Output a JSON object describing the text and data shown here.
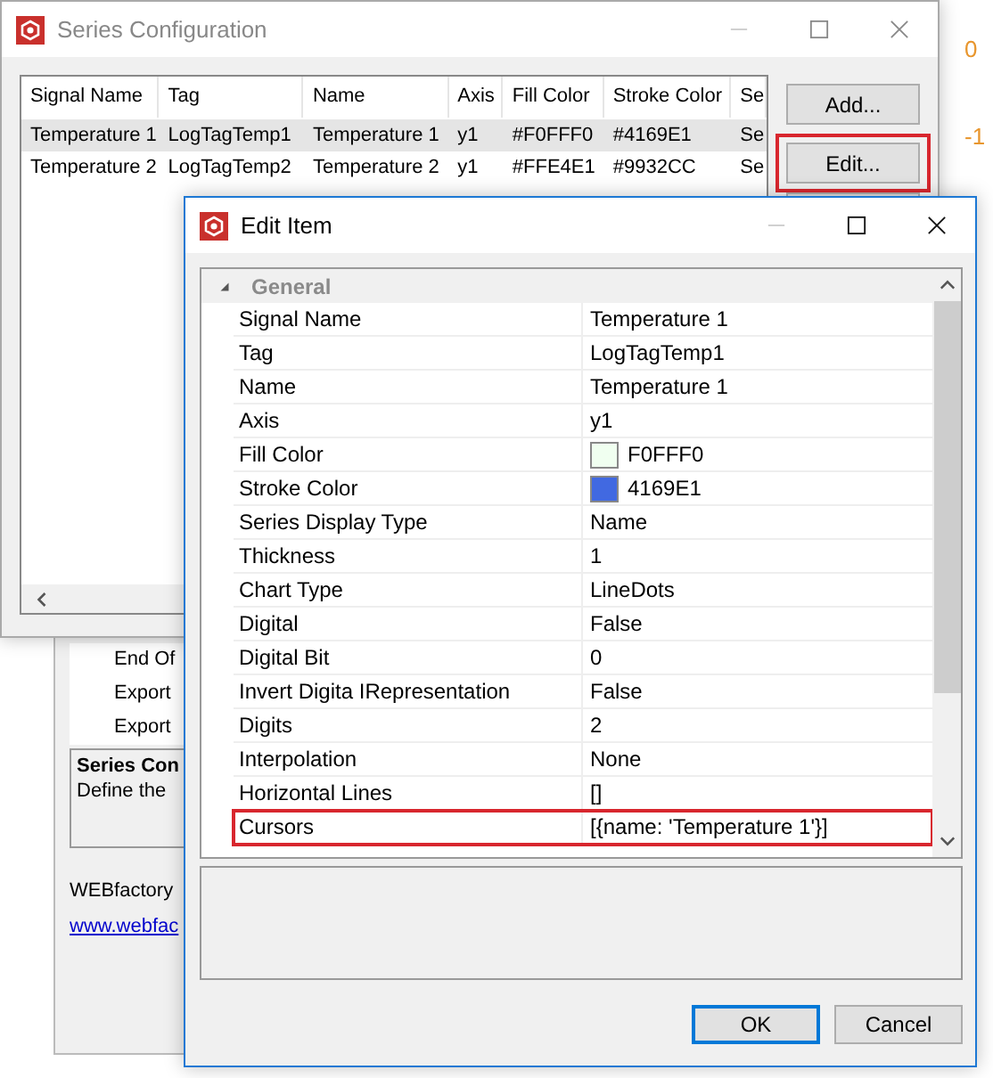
{
  "background_chart": {
    "axis_labels": [
      "0",
      "-1"
    ]
  },
  "series_window": {
    "title": "Series Configuration",
    "table": {
      "columns": [
        "Signal Name",
        "Tag",
        "Name",
        "Axis",
        "Fill Color",
        "Stroke Color",
        "Se"
      ],
      "rows": [
        {
          "cells": [
            "Temperature 1",
            "LogTagTemp1",
            "Temperature 1",
            "y1",
            "#F0FFF0",
            "#4169E1",
            "Se"
          ],
          "selected": true
        },
        {
          "cells": [
            "Temperature 2",
            "LogTagTemp2",
            "Temperature 2",
            "y1",
            "#FFE4E1",
            "#9932CC",
            "Se"
          ],
          "selected": false
        }
      ]
    },
    "buttons": [
      {
        "label": "Add...",
        "highlighted": false
      },
      {
        "label": "Edit...",
        "highlighted": true
      }
    ]
  },
  "main_panel": {
    "items": [
      "End Of",
      "Export",
      "Export"
    ],
    "info": {
      "title": "Series Con",
      "text": "Define the"
    },
    "footer": "WEBfactory",
    "link": "www.webfac"
  },
  "edit_window": {
    "title": "Edit Item",
    "category": {
      "label": "General",
      "expanded": true
    },
    "properties": [
      {
        "name": "Signal Name",
        "value": "Temperature 1",
        "highlighted": false
      },
      {
        "name": "Tag",
        "value": "LogTagTemp1",
        "highlighted": false
      },
      {
        "name": "Name",
        "value": "Temperature 1",
        "highlighted": false
      },
      {
        "name": "Axis",
        "value": "y1",
        "highlighted": false
      },
      {
        "name": "Fill Color",
        "value": "F0FFF0",
        "color": "#f0fff0",
        "highlighted": false
      },
      {
        "name": "Stroke Color",
        "value": "4169E1",
        "color": "#4169e1",
        "highlighted": false
      },
      {
        "name": "Series Display Type",
        "value": "Name",
        "highlighted": false
      },
      {
        "name": "Thickness",
        "value": "1",
        "highlighted": false
      },
      {
        "name": "Chart Type",
        "value": "LineDots",
        "highlighted": false
      },
      {
        "name": "Digital",
        "value": "False",
        "highlighted": false
      },
      {
        "name": "Digital Bit",
        "value": "0",
        "highlighted": false
      },
      {
        "name": "Invert Digita IRepresentation",
        "value": "False",
        "highlighted": false
      },
      {
        "name": "Digits",
        "value": "2",
        "highlighted": false
      },
      {
        "name": "Interpolation",
        "value": "None",
        "highlighted": false
      },
      {
        "name": "Horizontal Lines",
        "value": "[]",
        "highlighted": false
      },
      {
        "name": "Cursors",
        "value": "[{name: 'Temperature 1'}]",
        "highlighted": true
      }
    ],
    "buttons": [
      {
        "label": "OK",
        "default": true
      },
      {
        "label": "Cancel",
        "default": false
      }
    ]
  }
}
